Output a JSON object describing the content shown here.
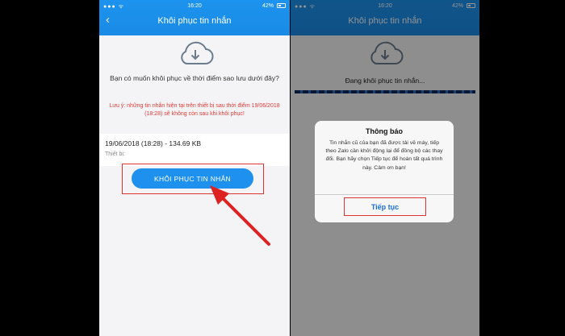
{
  "left_screen": {
    "status": {
      "time": "16:20",
      "battery": "42%"
    },
    "nav": {
      "title": "Khôi phục tin nhắn",
      "back_icon": "chevron-left-icon"
    },
    "icon": "cloud-download-icon",
    "question": "Bạn có muốn khôi phục về thời điểm sao lưu dưới đây?",
    "warning": "Lưu ý: những tin nhắn hiện tại trên thiết bị sau thời điểm 19/06/2018 (18:28) sẽ không còn sau khi khôi phục!",
    "backup": {
      "info": "19/06/2018 (18:28) - 134.69 KB",
      "device_label": "Thiết bị:"
    },
    "restore_button": "KHÔI PHỤC TIN NHẮN"
  },
  "right_screen": {
    "status": {
      "time": "16:20",
      "battery": "42%"
    },
    "nav": {
      "title": "Khôi phục tin nhắn"
    },
    "icon": "cloud-download-icon",
    "progress_text": "Đang khôi phục tin nhắn...",
    "dialog": {
      "title": "Thông báo",
      "body": "Tin nhắn cũ của bạn đã được tải về máy, tiếp theo Zalo cần khởi động lại để đồng bộ các thay đổi. Bạn hãy chọn Tiếp tục để hoàn tất quá trình này. Cảm ơn bạn!",
      "button": "Tiếp tục"
    }
  },
  "colors": {
    "header_blue": "#1c93ee",
    "highlight_red": "#dd2222",
    "warning_red": "#e53935"
  }
}
